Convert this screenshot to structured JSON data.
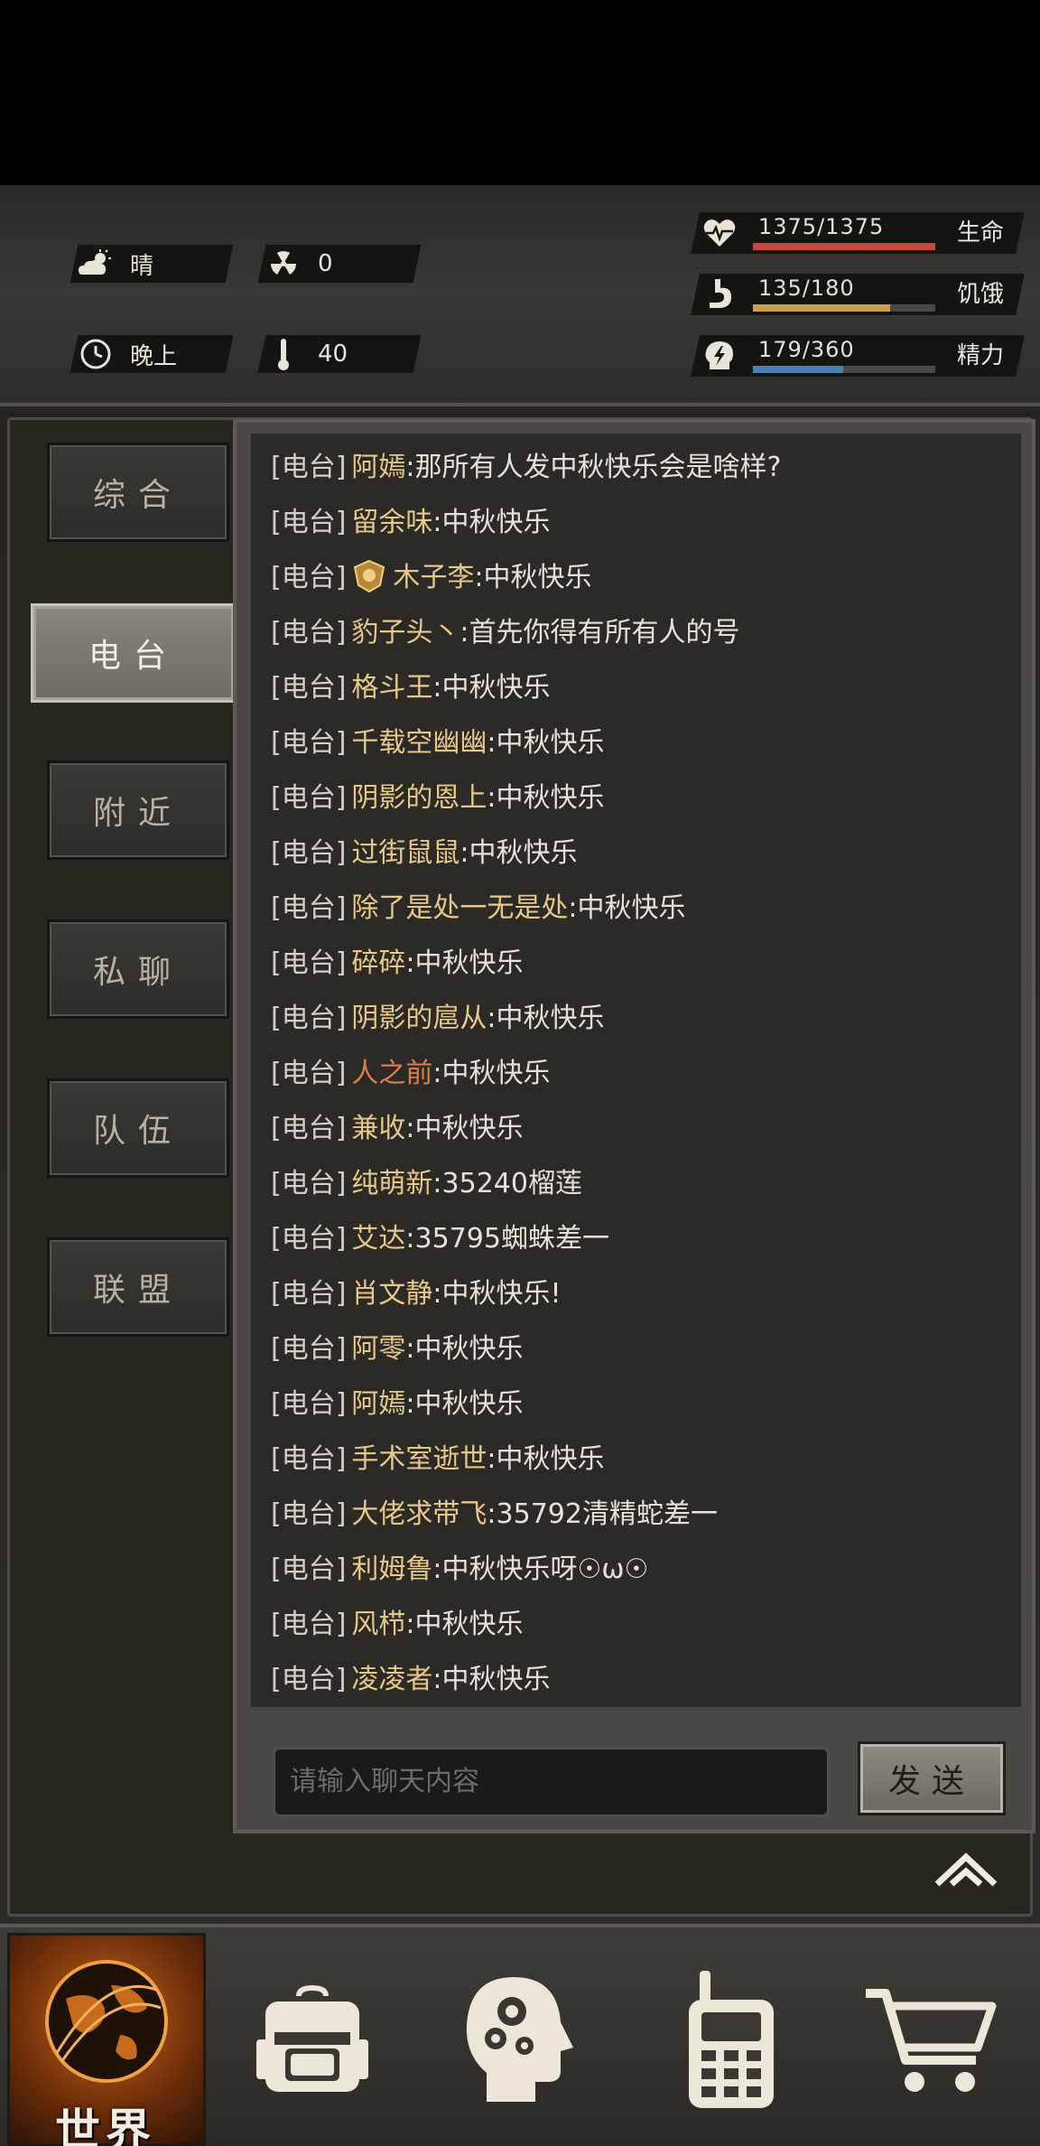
{
  "status": {
    "weather": "晴",
    "radiation": "0",
    "time_of_day": "晚上",
    "temperature": "40",
    "health": {
      "value": "1375/1375",
      "label": "生命",
      "fraction": 1.0,
      "color": "#c8473c"
    },
    "hunger": {
      "value": "135/180",
      "label": "饥饿",
      "fraction": 0.75,
      "color": "#c8a050"
    },
    "energy": {
      "value": "179/360",
      "label": "精力",
      "fraction": 0.497,
      "color": "#4a7fb8"
    }
  },
  "tabs": [
    {
      "label": "综合",
      "active": false
    },
    {
      "label": "电台",
      "active": true
    },
    {
      "label": "附近",
      "active": false
    },
    {
      "label": "私聊",
      "active": false
    },
    {
      "label": "队伍",
      "active": false
    },
    {
      "label": "联盟",
      "active": false
    }
  ],
  "chat": {
    "channel_tag": "[电台]",
    "messages": [
      {
        "name": "阿嫣",
        "text": ":那所有人发中秋快乐会是啥样?"
      },
      {
        "name": "留余味",
        "text": ":中秋快乐"
      },
      {
        "name": "木子李",
        "text": ":中秋快乐",
        "badge": true
      },
      {
        "name": "豹子头丶",
        "text": ":首先你得有所有人的号"
      },
      {
        "name": "格斗王",
        "text": ":中秋快乐"
      },
      {
        "name": "千载空幽幽",
        "text": ":中秋快乐"
      },
      {
        "name": "阴影的恩上",
        "text": ":中秋快乐"
      },
      {
        "name": "过街鼠鼠",
        "text": ":中秋快乐"
      },
      {
        "name": "除了是处一无是处",
        "text": ":中秋快乐"
      },
      {
        "name": "碎碎",
        "text": ":中秋快乐"
      },
      {
        "name": "阴影的扈从",
        "text": ":中秋快乐"
      },
      {
        "name": "人之前",
        "text": ":中秋快乐",
        "orange": true
      },
      {
        "name": "兼收",
        "text": ":中秋快乐"
      },
      {
        "name": "纯萌新",
        "text": ":35240榴莲"
      },
      {
        "name": "艾达",
        "text": ":35795蜘蛛差一"
      },
      {
        "name": "肖文静",
        "text": ":中秋快乐!"
      },
      {
        "name": "阿零",
        "text": ":中秋快乐"
      },
      {
        "name": "阿嫣",
        "text": ":中秋快乐"
      },
      {
        "name": "手术室逝世",
        "text": ":中秋快乐"
      },
      {
        "name": "大佬求带飞",
        "text": ":35792清精蛇差一"
      },
      {
        "name": "利姆鲁",
        "text": ":中秋快乐呀☉ω☉"
      },
      {
        "name": "风栉",
        "text": ":中秋快乐"
      },
      {
        "name": "凌凌者",
        "text": ":中秋快乐"
      }
    ],
    "input_placeholder": "请输入聊天内容",
    "send_label": "发送"
  },
  "nav": {
    "world_label": "世界",
    "items": [
      "globe-icon",
      "backpack-icon",
      "skills-head-icon",
      "radio-icon",
      "cart-icon"
    ]
  }
}
